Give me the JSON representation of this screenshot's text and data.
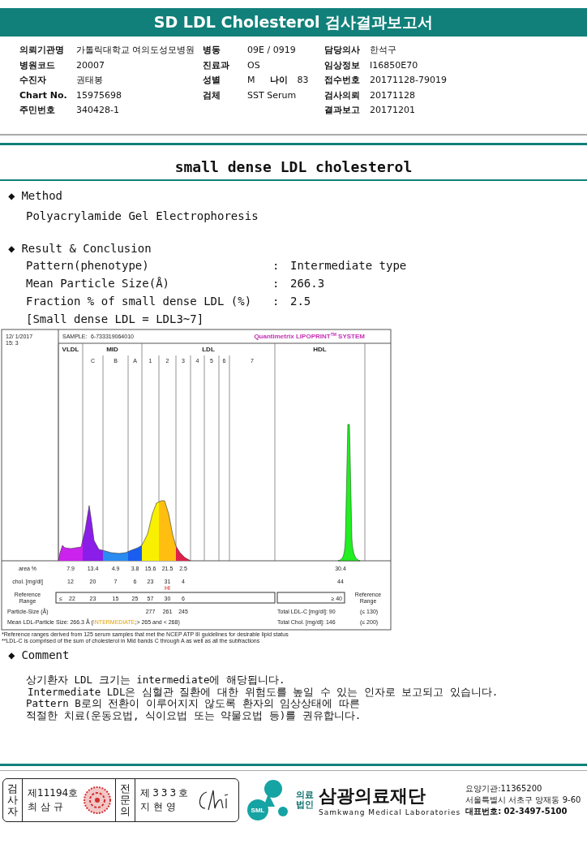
{
  "title": "SD LDL Cholesterol 검사결과보고서",
  "info_rows": [
    {
      "left": {
        "label": "의뢰기관명",
        "value": "가톨릭대학교 여의도성모병원"
      },
      "middle": [
        {
          "label": "병동",
          "value": "09E / 0919"
        }
      ],
      "right": {
        "label": "담당의사",
        "value": "한석구"
      }
    },
    {
      "left": {
        "label": "병원코드",
        "value": "20007"
      },
      "middle": [
        {
          "label": "진료과",
          "value": "OS"
        }
      ],
      "right": {
        "label": "임상정보",
        "value": "I16850E70"
      }
    },
    {
      "left": {
        "label": "수진자",
        "value": "권태봉"
      },
      "middle": [
        {
          "label": "성별",
          "value": "M"
        },
        {
          "label": "나이",
          "value": "83"
        }
      ],
      "right": {
        "label": "접수번호",
        "value": "20171128-79019"
      }
    },
    {
      "left": {
        "label": "Chart No.",
        "value": "15975698"
      },
      "middle": [
        {
          "label": "검체",
          "value": "SST Serum"
        }
      ],
      "right": {
        "label": "검사의뢰",
        "value": "20171128"
      }
    },
    {
      "left": {
        "label": "주민번호",
        "value": "340428-1"
      },
      "right": {
        "label": "결과보고",
        "value": "20171201"
      }
    }
  ],
  "section_title": "small dense LDL cholesterol",
  "method": {
    "marker": "◆",
    "heading": "Method",
    "text": "Polyacrylamide Gel Electrophoresis"
  },
  "result": {
    "marker": "◆",
    "heading": "Result & Conclusion",
    "rows": [
      {
        "label": "Pattern(phenotype)",
        "separator": ":",
        "value": "Intermediate type"
      },
      {
        "label": "Mean Particle Size(Å)",
        "separator": ":",
        "value": "266.3"
      },
      {
        "label": "Fraction % of small dense LDL (%)",
        "separator": ":",
        "value": "2.5"
      }
    ],
    "note": "[Small dense LDL = LDL3~7]"
  },
  "chart": {
    "date": "12/ 1/2017",
    "time": "15: 3",
    "sample_label": "SAMPLE:",
    "sample_id": "6-733319064010",
    "brand": "Quantimetrix LIPOPRINT",
    "brand_mark": "TM",
    "brand_tail": "SYSTEM",
    "groups": [
      "VLDL",
      "MID",
      "LDL",
      "HDL"
    ],
    "bands": [
      "C",
      "B",
      "A",
      "1",
      "2",
      "3",
      "4",
      "5",
      "6",
      "7"
    ],
    "area_label": "area %",
    "area": [
      "7.9",
      "13.4",
      "4.9",
      "3.8",
      "15.6",
      "21.5",
      "2.5"
    ],
    "hdl_area": "30.4",
    "chol_label": "chol. [mg/dl]",
    "chol": [
      {
        "value": "12"
      },
      {
        "value": "20"
      },
      {
        "value": "7"
      },
      {
        "value": "6"
      },
      {
        "value": "23"
      },
      {
        "value": "31",
        "flag": "HI"
      },
      {
        "value": "4"
      }
    ],
    "hdl_chol": "44",
    "ref_label": "Reference Range",
    "ref_prefix": "≤",
    "ref": [
      "22",
      "23",
      "15",
      "25",
      "57",
      "30",
      "6"
    ],
    "hdl_ref": "≥ 40",
    "ref_label_right": "Reference Range",
    "size_label": "Particle-Size (Å)",
    "sizes": [
      "277",
      "261",
      "245"
    ],
    "mean_label": "Mean LDL-Particle Size:",
    "mean_value": "266.3 Å (",
    "mean_class": "INTERMEDIATE",
    "mean_range": ";> 265 and < 268)",
    "total_ldl_label": "Total LDL-C [mg/dl]:",
    "total_ldl": "90",
    "total_ldl_ref": "(≤ 130)",
    "total_chol_label": "Total Chol. [mg/dl]:",
    "total_chol": "146",
    "total_chol_ref": "(≤ 200)",
    "footnotes": [
      "*Reference ranges derived from 125 serum samples that met the NCEP ATP III guidelines for desirable lipid status",
      "**LDL-C is comprised of the sum of cholesterol in Mid bands C through A as well as all the subfractions"
    ]
  },
  "comment": {
    "marker": "◆",
    "heading": "Comment",
    "lines": [
      "상기환자 LDL 크기는 intermediate에 해당됩니다.",
      "Intermediate LDL은 심혈관 질환에 대한 위험도를 높일 수 있는 인자로 보고되고 있습니다.",
      "Pattern B로의 전환이 이루어지지 않도록 환자의 임상상태에 따른",
      "적절한 치료(운동요법, 식이요법 또는 약물요법 등)를 권유합니다."
    ]
  },
  "footer": {
    "examiner": {
      "label": "검사자",
      "license": "제11194호",
      "name": "최 삼 규"
    },
    "specialist": {
      "label": "전문의",
      "license": "제333호",
      "name": "지 현 영"
    },
    "org": {
      "logo_text": "SML",
      "type": "의료법인",
      "name": "삼광의료재단",
      "english": "Samkwang Medical Laboratories",
      "details": [
        "요양기관:11365200",
        "서울특별시 서초구 양재동 9-60",
        "대표번호: 02-3497-5100"
      ]
    }
  }
}
